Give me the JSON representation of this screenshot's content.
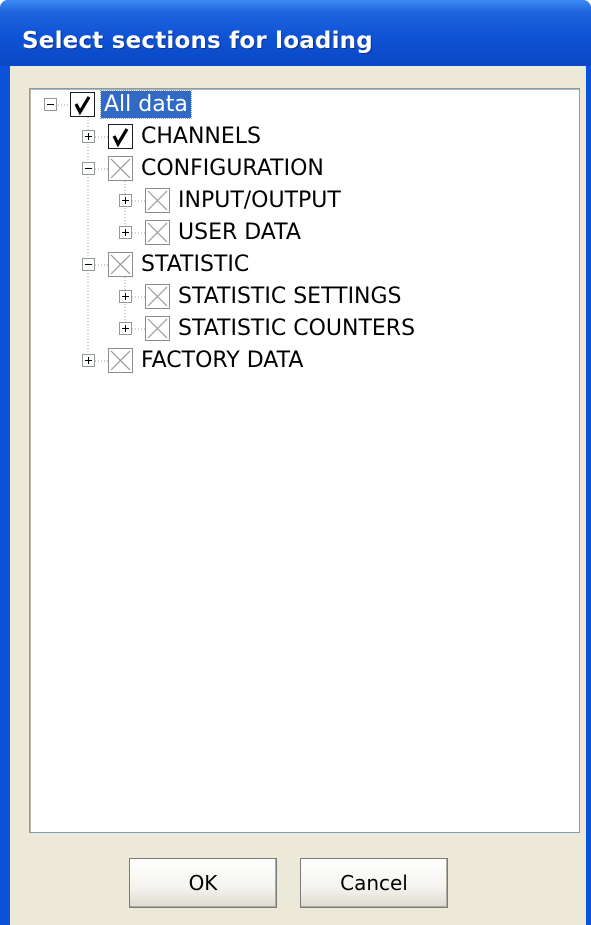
{
  "window": {
    "title": "Select sections for loading"
  },
  "tree": {
    "nodes": [
      {
        "label": "All data",
        "checked": true,
        "expanded": true,
        "selected": true
      },
      {
        "label": "CHANNELS",
        "checked": true,
        "expanded": false
      },
      {
        "label": "CONFIGURATION",
        "checked": false,
        "expanded": true
      },
      {
        "label": "INPUT/OUTPUT",
        "checked": false,
        "expanded": false
      },
      {
        "label": "USER DATA",
        "checked": false,
        "expanded": false
      },
      {
        "label": "STATISTIC",
        "checked": false,
        "expanded": true
      },
      {
        "label": "STATISTIC SETTINGS",
        "checked": false,
        "expanded": false
      },
      {
        "label": "STATISTIC COUNTERS",
        "checked": false,
        "expanded": false
      },
      {
        "label": "FACTORY DATA",
        "checked": false,
        "expanded": false
      }
    ]
  },
  "buttons": {
    "ok": "OK",
    "cancel": "Cancel"
  }
}
